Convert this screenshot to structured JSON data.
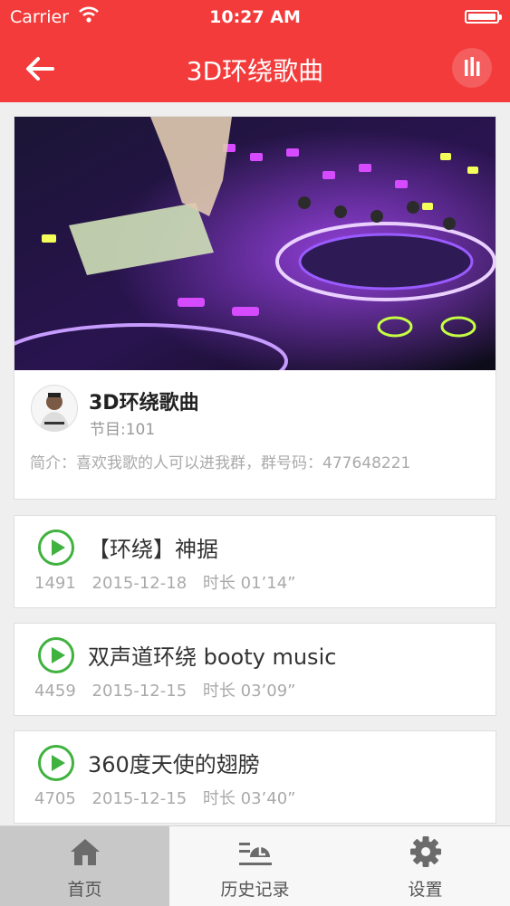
{
  "status": {
    "carrier": "Carrier",
    "time": "10:27 AM"
  },
  "header": {
    "title": "3D环绕歌曲",
    "back_icon": "arrow-left-icon",
    "menu_icon": "equalizer-icon",
    "color": "#f33b3b"
  },
  "channel": {
    "title": "3D环绕歌曲",
    "count": "节目:101",
    "description": "简介：喜欢我歌的人可以进我群，群号码：477648221"
  },
  "tracks": [
    {
      "title": "【环绕】神据",
      "plays": "1491",
      "date": "2015-12-18",
      "duration": "时长 01’14”"
    },
    {
      "title": "双声道环绕 booty music",
      "plays": "4459",
      "date": "2015-12-15",
      "duration": "时长 03’09”"
    },
    {
      "title": "360度天使的翅膀",
      "plays": "4705",
      "date": "2015-12-15",
      "duration": "时长 03’40”"
    }
  ],
  "tabs": [
    {
      "label": "首页",
      "icon": "home-icon",
      "active": true
    },
    {
      "label": "历史记录",
      "icon": "history-icon",
      "active": false
    },
    {
      "label": "设置",
      "icon": "gear-icon",
      "active": false
    }
  ]
}
